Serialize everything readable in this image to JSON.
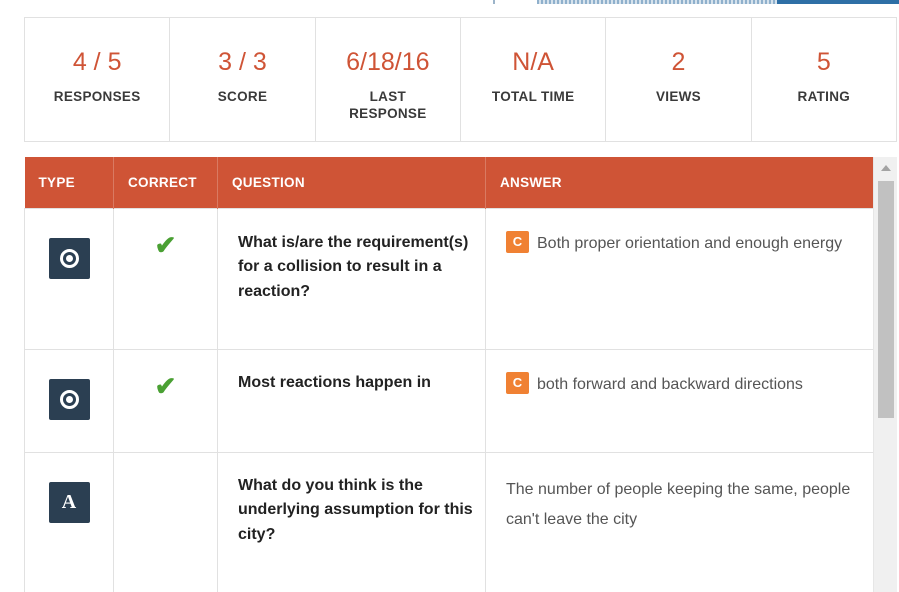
{
  "stats": [
    {
      "value": "4 / 5",
      "label": "RESPONSES"
    },
    {
      "value": "3 / 3",
      "label": "SCORE"
    },
    {
      "value": "6/18/16",
      "label": "LAST RESPONSE"
    },
    {
      "value": "N/A",
      "label": "TOTAL TIME"
    },
    {
      "value": "2",
      "label": "VIEWS"
    },
    {
      "value": "5",
      "label": "RATING"
    }
  ],
  "table": {
    "headers": {
      "type": "TYPE",
      "correct": "CORRECT",
      "question": "QUESTION",
      "answer": "ANSWER"
    },
    "rows": [
      {
        "type_icon": "radio-choice-icon",
        "correct": true,
        "question": "What is/are the requirement(s) for a collision to result in a reaction?",
        "badge": "C",
        "answer": "Both proper orientation and enough energy"
      },
      {
        "type_icon": "radio-choice-icon",
        "correct": true,
        "question": "Most reactions happen in",
        "badge": "C",
        "answer": "both forward and backward directions"
      },
      {
        "type_icon": "text-answer-icon",
        "type_glyph": "A",
        "correct": false,
        "question": "What do you think is the underlying assumption for this city?",
        "badge": "",
        "answer": "The number of people keeping the same, people can't leave the city"
      }
    ]
  },
  "colors": {
    "accent": "#cf5436",
    "badge": "#f08133",
    "check": "#4aa033",
    "icon_bg": "#2b3f52"
  }
}
